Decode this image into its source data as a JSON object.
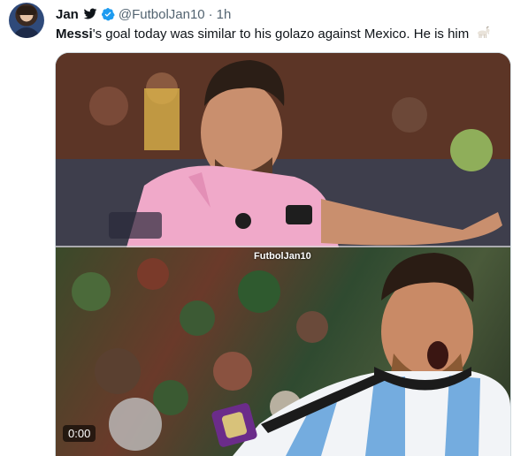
{
  "author": {
    "name": "Jan",
    "handle": "@FutbolJan10",
    "separator": "·",
    "time": "1h"
  },
  "tweet": {
    "bold_prefix": "Messi",
    "text": "'s goal today was similar to his golazo against Mexico. He is him"
  },
  "media": {
    "watermark": "FutbolJan10",
    "timecode": "0:00"
  },
  "colors": {
    "verified": "#1d9bf0",
    "secondary_text": "#536471",
    "inter_miami_pink": "#f0a9c9",
    "argentina_blue": "#74acdf"
  },
  "icons": {
    "bird": "twitter-bird-icon",
    "verified": "verified-badge-icon",
    "emoji": "goat-emoji-icon"
  }
}
